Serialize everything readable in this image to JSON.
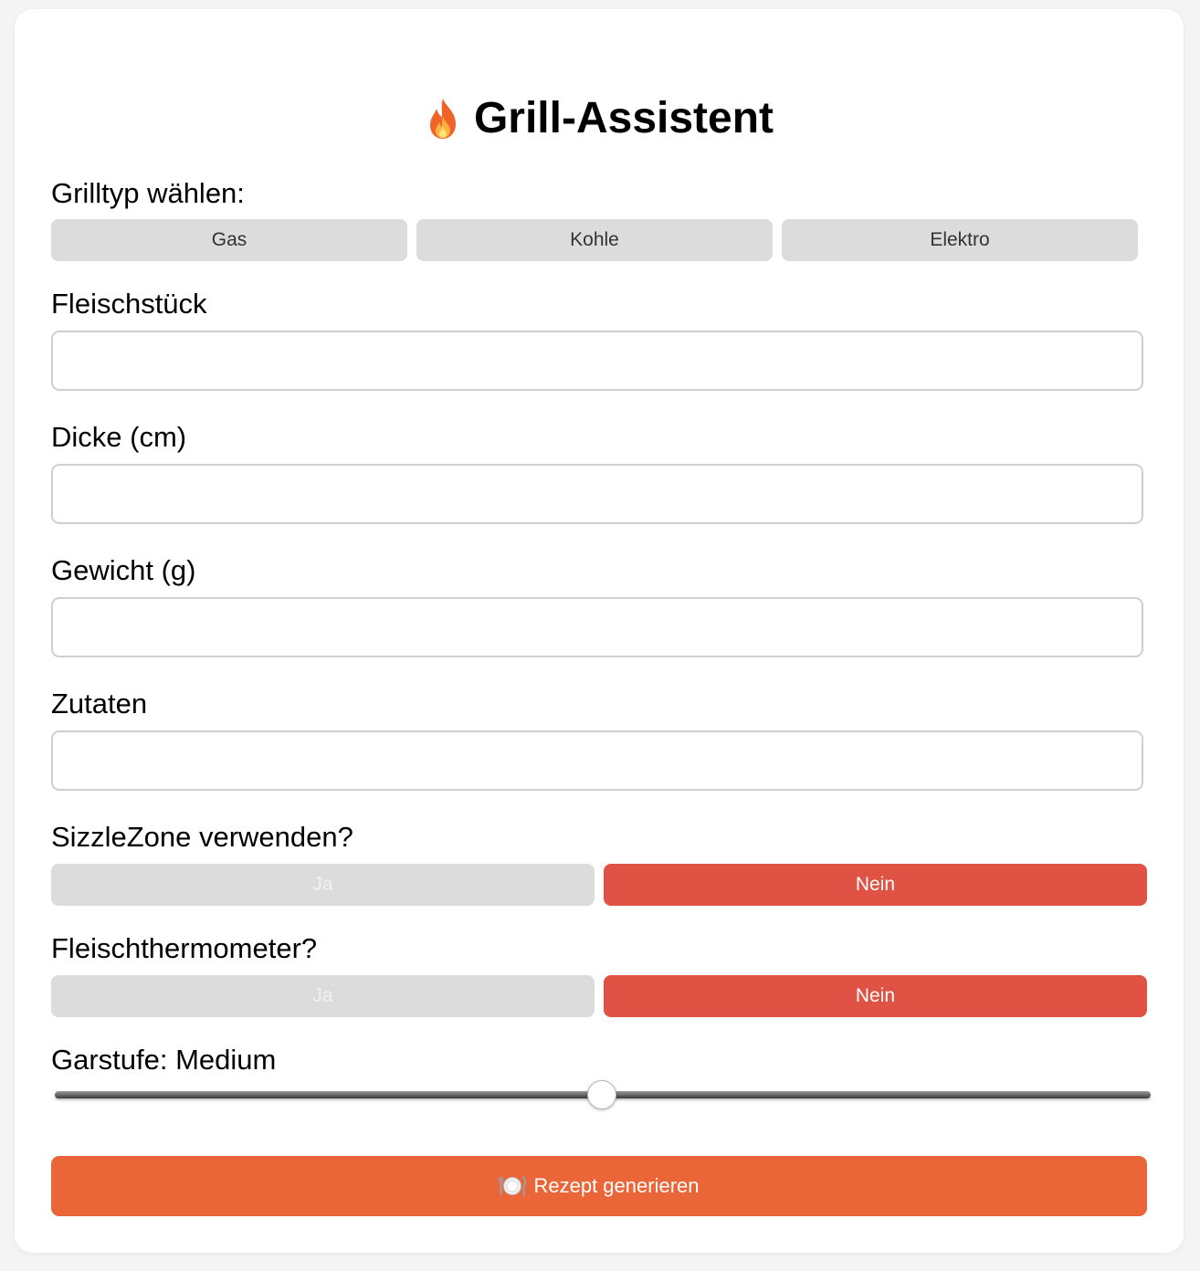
{
  "header": {
    "icon": "fire-icon",
    "title": "Grill-Assistent"
  },
  "grill_type": {
    "label": "Grilltyp wählen:",
    "options": [
      "Gas",
      "Kohle",
      "Elektro"
    ]
  },
  "fields": {
    "meat": {
      "label": "Fleischstück",
      "value": "",
      "placeholder": ""
    },
    "thickness": {
      "label": "Dicke (cm)",
      "value": "",
      "placeholder": ""
    },
    "weight": {
      "label": "Gewicht (g)",
      "value": "",
      "placeholder": ""
    },
    "ingredients": {
      "label": "Zutaten",
      "value": "",
      "placeholder": ""
    }
  },
  "sizzlezone": {
    "label": "SizzleZone verwenden?",
    "yes": "Ja",
    "no": "Nein",
    "selected": "Nein"
  },
  "thermometer": {
    "label": "Fleischthermometer?",
    "yes": "Ja",
    "no": "Nein",
    "selected": "Nein"
  },
  "doneness": {
    "label": "Garstufe: Medium",
    "slider_fraction": 0.5
  },
  "generate": {
    "icon": "plate-cutlery-icon",
    "label": "Rezept generieren"
  },
  "colors": {
    "active_toggle": "#e05243",
    "primary_button": "#ea6538",
    "inactive_button": "#dcdcdc"
  }
}
